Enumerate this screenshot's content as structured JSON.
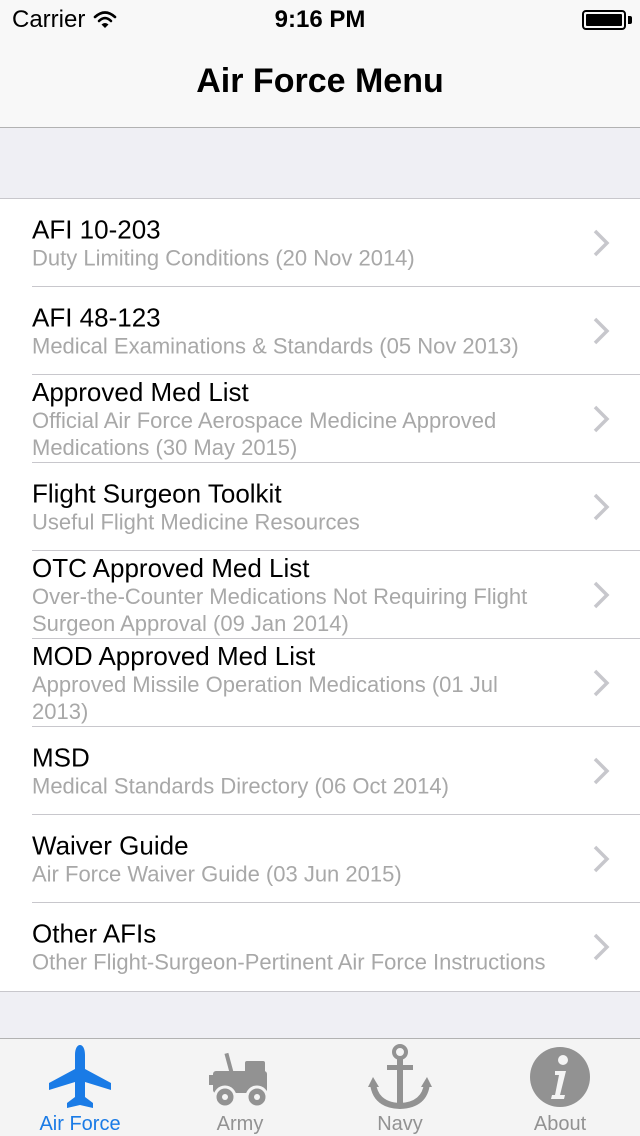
{
  "status_bar": {
    "carrier": "Carrier",
    "time": "9:16 PM",
    "battery_level": 1.0
  },
  "nav": {
    "title": "Air Force Menu"
  },
  "menu": {
    "items": [
      {
        "title": "AFI 10-203",
        "subtitle": "Duty Limiting Conditions (20 Nov 2014)"
      },
      {
        "title": "AFI 48-123",
        "subtitle": "Medical Examinations & Standards (05 Nov 2013)"
      },
      {
        "title": "Approved Med List",
        "subtitle": "Official Air Force Aerospace Medicine Approved Medications (30 May 2015)"
      },
      {
        "title": "Flight Surgeon Toolkit",
        "subtitle": "Useful Flight Medicine Resources"
      },
      {
        "title": "OTC Approved Med List",
        "subtitle": "Over-the-Counter Medications Not Requiring Flight Surgeon Approval (09 Jan 2014)"
      },
      {
        "title": "MOD Approved Med List",
        "subtitle": "Approved Missile Operation Medications (01 Jul 2013)"
      },
      {
        "title": "MSD",
        "subtitle": "Medical Standards Directory (06 Oct 2014)"
      },
      {
        "title": "Waiver Guide",
        "subtitle": "Air Force Waiver Guide (03 Jun 2015)"
      },
      {
        "title": "Other AFIs",
        "subtitle": "Other Flight-Surgeon-Pertinent Air Force Instructions"
      }
    ]
  },
  "tabs": [
    {
      "label": "Air Force",
      "icon": "airplane-icon",
      "active": true
    },
    {
      "label": "Army",
      "icon": "jeep-icon",
      "active": false
    },
    {
      "label": "Navy",
      "icon": "anchor-icon",
      "active": false
    },
    {
      "label": "About",
      "icon": "info-icon",
      "active": false
    }
  ],
  "colors": {
    "accent": "#1a7be6",
    "inactive_tab": "#929292",
    "subtitle": "#a8a8a8",
    "chevron": "#c7c7cc"
  }
}
